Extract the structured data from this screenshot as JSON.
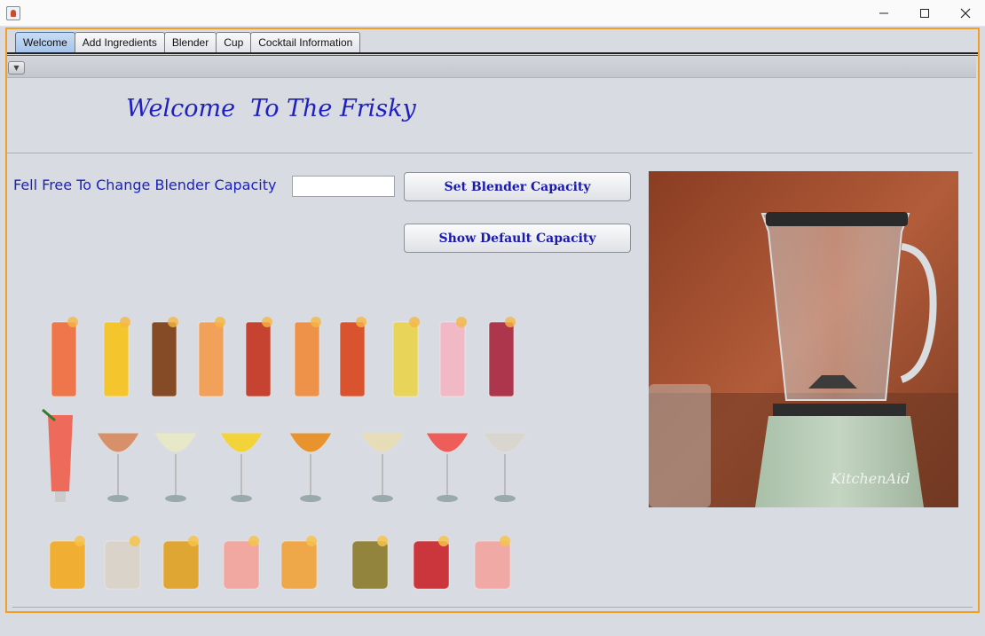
{
  "window": {
    "icon": "java-app-icon",
    "controls": [
      "minimize-icon",
      "maximize-icon",
      "close-icon"
    ]
  },
  "tabs": [
    {
      "label": "Welcome",
      "active": true
    },
    {
      "label": "Add Ingredients",
      "active": false
    },
    {
      "label": "Blender",
      "active": false
    },
    {
      "label": "Cup",
      "active": false
    },
    {
      "label": "Cocktail Information",
      "active": false
    }
  ],
  "panel": {
    "collapse_icon": "triangle-down-icon",
    "welcome_text": "Welcome  To The Frisky"
  },
  "capacity": {
    "label": "Fell Free To Change Blender Capacity",
    "input_value": "",
    "set_button": "Set Blender Capacity",
    "show_button": "Show Default Capacity"
  },
  "images": {
    "blender_photo": "blender-photo",
    "cocktail_rows": [
      10,
      8,
      8
    ]
  },
  "colors": {
    "accent": "#f2a024",
    "text_blue": "#1a22c2",
    "background": "#d9dbe2"
  }
}
